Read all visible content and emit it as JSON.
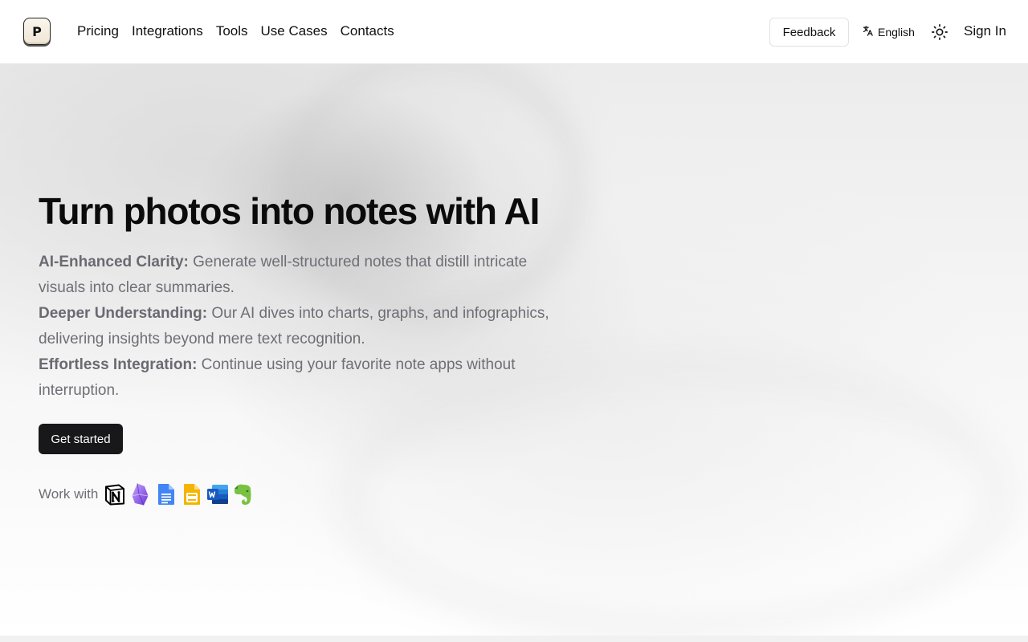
{
  "header": {
    "logo_letter": "P",
    "nav": [
      "Pricing",
      "Integrations",
      "Tools",
      "Use Cases",
      "Contacts"
    ],
    "feedback_label": "Feedback",
    "language_label": "English",
    "signin_label": "Sign In"
  },
  "hero": {
    "title": "Turn photos into notes with AI",
    "features": [
      {
        "heading": "AI-Enhanced Clarity:",
        "text": " Generate well-structured notes that distill intricate visuals into clear summaries."
      },
      {
        "heading": "Deeper Understanding:",
        "text": " Our AI dives into charts, graphs, and infographics, delivering insights beyond mere text recognition."
      },
      {
        "heading": "Effortless Integration:",
        "text": " Continue using your favorite note apps without interruption."
      }
    ],
    "cta_label": "Get started",
    "work_with_label": "Work with",
    "apps": [
      "notion-icon",
      "obsidian-icon",
      "google-docs-icon",
      "google-slides-icon",
      "microsoft-word-icon",
      "evernote-icon"
    ]
  },
  "colors": {
    "primary_button": "#18181b",
    "muted_text": "#6e6e76",
    "title_text": "#0b0b0b"
  }
}
